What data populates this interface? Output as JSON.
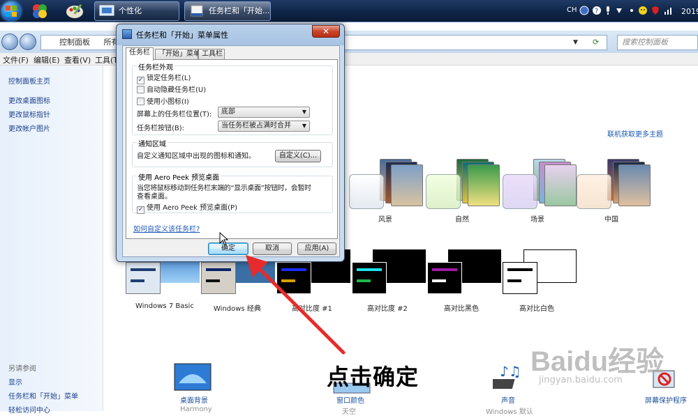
{
  "taskbar": {
    "tasks": [
      {
        "label": "个性化",
        "icon": "personalization-icon"
      },
      {
        "label": "任务栏和「开始...",
        "icon": "taskbar-properties-icon"
      }
    ],
    "tray": {
      "lang": "CH",
      "clock": "2019"
    }
  },
  "explorer": {
    "address": [
      "控制面板",
      "所有控"
    ],
    "search_placeholder": "搜索控制面板",
    "menu": [
      "文件(F)",
      "编辑(E)",
      "查看(V)",
      "工具(T)"
    ],
    "sidebar": {
      "links": [
        "控制面板主页",
        "更改桌面图标",
        "更改鼠标指针",
        "更改帐户图片"
      ],
      "see_also_title": "另请参阅",
      "see_also": [
        "显示",
        "任务栏和「开始」菜单",
        "轻松访问中心"
      ]
    },
    "online_link": "联机获取更多主题",
    "themes": [
      "风景",
      "自然",
      "场景",
      "中国"
    ],
    "basic_themes": [
      "Windows 7 Basic",
      "Windows 经典",
      "高对比度 #1",
      "高对比度 #2",
      "高对比黑色",
      "高对比白色"
    ],
    "bottom": {
      "desktop_bg": "桌面背景",
      "desktop_bg_sub": "Harmony",
      "window_color": "窗口颜色",
      "window_color_sub": "天空",
      "sound": "声音",
      "sound_sub": "Windows 默认",
      "screensaver": "屏幕保护程序"
    }
  },
  "dialog": {
    "title": "任务栏和「开始」菜单属性",
    "close": "✕",
    "tabs": [
      "任务栏",
      "「开始」菜单",
      "工具栏"
    ],
    "appearance": {
      "title": "任务栏外观",
      "lock": "锁定任务栏(L)",
      "autohide": "自动隐藏任务栏(U)",
      "small_icons": "使用小图标(I)",
      "position_label": "屏幕上的任务栏位置(T):",
      "position_value": "底部",
      "buttons_label": "任务栏按钮(B):",
      "buttons_value": "当任务栏被占满时合并"
    },
    "notify": {
      "title": "通知区域",
      "desc": "自定义通知区域中出现的图标和通知。",
      "customize": "自定义(C)..."
    },
    "peek": {
      "title": "使用 Aero Peek 预览桌面",
      "desc1": "当您将鼠标移动到任务栏末端的“显示桌面”按钮时，会暂时",
      "desc2": "查看桌面。",
      "check": "使用 Aero Peek 预览桌面(P)"
    },
    "help_link": "如何自定义该任务栏?",
    "buttons": {
      "ok": "确定",
      "cancel": "取消",
      "apply": "应用(A)"
    }
  },
  "overlay": {
    "caption": "点击确定"
  },
  "watermark": {
    "logo": "Baidu经验",
    "url": "jingyan.baidu.com"
  }
}
